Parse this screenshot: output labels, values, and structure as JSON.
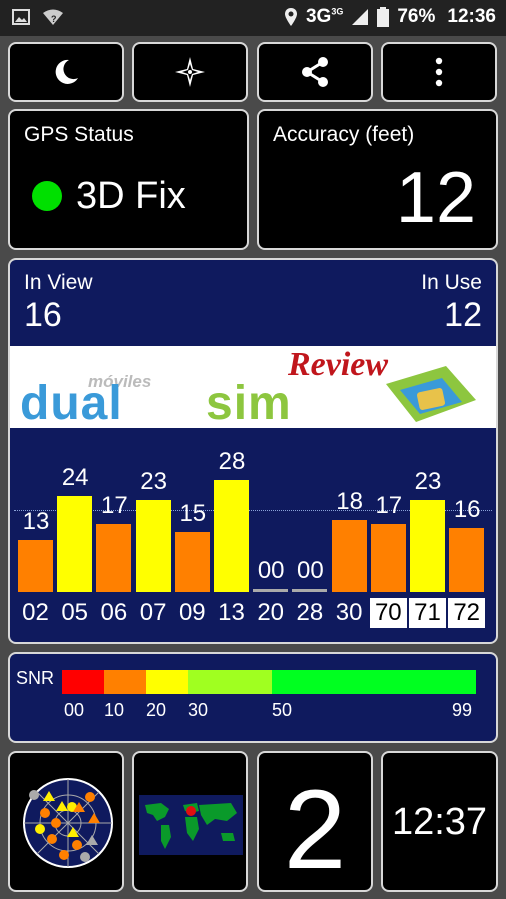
{
  "status_bar": {
    "network_label": "3G",
    "network_sup": "3G",
    "battery": "76%",
    "time": "12:36"
  },
  "toolbar": {
    "buttons": [
      {
        "icon": "moon-icon"
      },
      {
        "icon": "compass-rose-icon"
      },
      {
        "icon": "share-icon"
      },
      {
        "icon": "more-vert-icon"
      }
    ]
  },
  "gps_status": {
    "label": "GPS Status",
    "value": "3D Fix",
    "indicator_color": "#00e000"
  },
  "accuracy": {
    "label": "Accuracy (feet)",
    "value": "12"
  },
  "satellites": {
    "in_view_label": "In View",
    "in_view": "16",
    "in_use_label": "In Use",
    "in_use": "12"
  },
  "banner": {
    "moviles": "móviles",
    "dual": "dual",
    "sim": "sim",
    "review": "Review"
  },
  "chart_data": {
    "type": "bar",
    "categories": [
      "02",
      "05",
      "06",
      "07",
      "09",
      "13",
      "20",
      "28",
      "30",
      "70",
      "71",
      "72"
    ],
    "values": [
      13,
      24,
      17,
      23,
      15,
      28,
      0,
      0,
      18,
      17,
      23,
      16
    ],
    "value_labels": [
      "13",
      "24",
      "17",
      "23",
      "15",
      "28",
      "00",
      "00",
      "18",
      "17",
      "23",
      "16"
    ],
    "highlighted_prns": [
      "70",
      "71",
      "72"
    ],
    "ylim": [
      0,
      30
    ],
    "grid": "dotted-line"
  },
  "snr_legend": {
    "label": "SNR",
    "ticks": [
      "00",
      "10",
      "20",
      "30",
      "50",
      "99"
    ],
    "colors": [
      "#ff0000",
      "#ff8000",
      "#ffff00",
      "#a0ff20",
      "#00ff20"
    ]
  },
  "bottom": {
    "satellite_count": "2",
    "clock": "12:37"
  }
}
